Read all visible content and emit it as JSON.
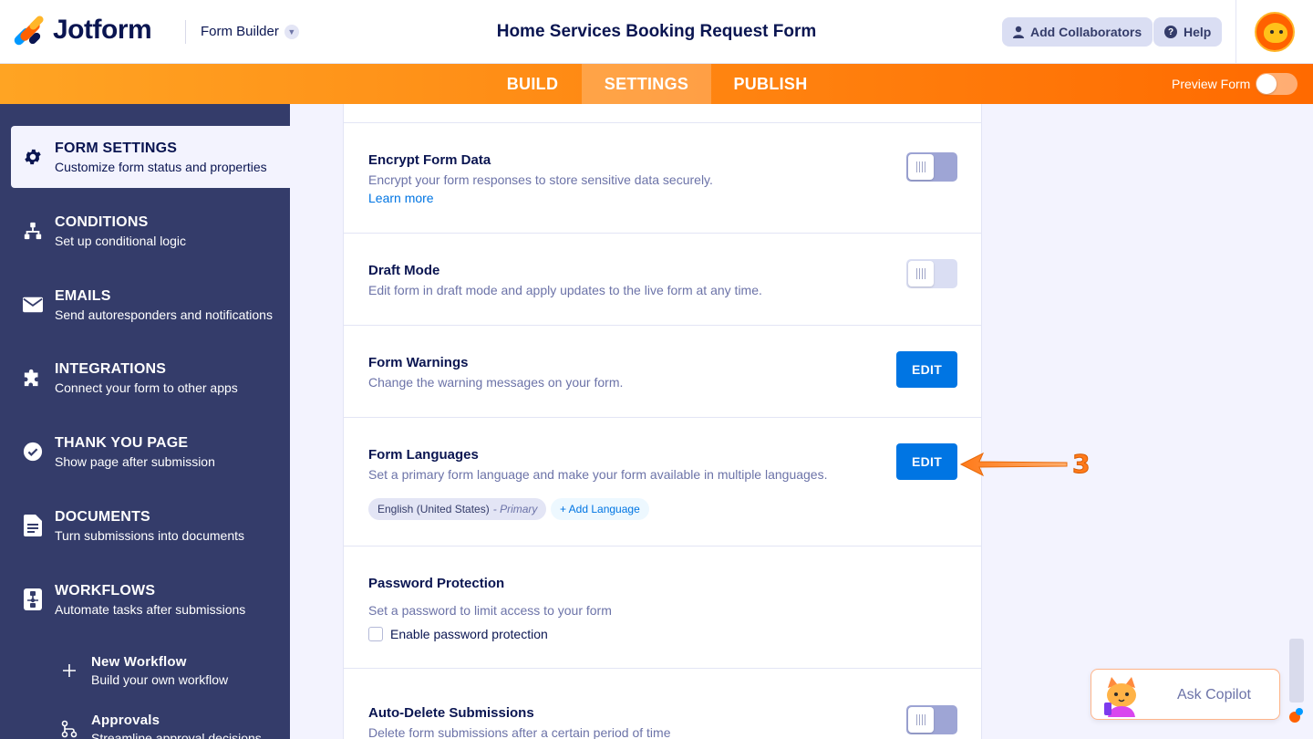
{
  "header": {
    "logo_text": "Jotform",
    "builder_label": "Form Builder",
    "form_title": "Home Services Booking Request Form",
    "add_collaborators": "Add Collaborators",
    "help": "Help"
  },
  "nav": {
    "tabs": [
      {
        "label": "BUILD"
      },
      {
        "label": "SETTINGS"
      },
      {
        "label": "PUBLISH"
      }
    ],
    "active_tab": "SETTINGS",
    "preview_label": "Preview Form"
  },
  "sidebar": {
    "items": [
      {
        "title": "FORM SETTINGS",
        "subtitle": "Customize form status and properties",
        "icon": "gear-icon"
      },
      {
        "title": "CONDITIONS",
        "subtitle": "Set up conditional logic",
        "icon": "hierarchy-icon"
      },
      {
        "title": "EMAILS",
        "subtitle": "Send autoresponders and notifications",
        "icon": "envelope-icon"
      },
      {
        "title": "INTEGRATIONS",
        "subtitle": "Connect your form to other apps",
        "icon": "puzzle-icon"
      },
      {
        "title": "THANK YOU PAGE",
        "subtitle": "Show page after submission",
        "icon": "check-circle-icon"
      },
      {
        "title": "DOCUMENTS",
        "subtitle": "Turn submissions into documents",
        "icon": "document-icon"
      },
      {
        "title": "WORKFLOWS",
        "subtitle": "Automate tasks after submissions",
        "icon": "workflow-icon"
      }
    ],
    "sub_items": [
      {
        "title": "New Workflow",
        "subtitle": "Build your own workflow",
        "icon": "plus-icon"
      },
      {
        "title": "Approvals",
        "subtitle": "Streamline approval decisions",
        "icon": "approval-flow-icon"
      }
    ]
  },
  "settings": {
    "encrypt": {
      "title": "Encrypt Form Data",
      "desc": "Encrypt your form responses to store sensitive data securely.",
      "link": "Learn more",
      "enabled": false
    },
    "draft": {
      "title": "Draft Mode",
      "desc": "Edit form in draft mode and apply updates to the live form at any time.",
      "enabled": false
    },
    "warnings": {
      "title": "Form Warnings",
      "desc": "Change the warning messages on your form.",
      "button": "EDIT"
    },
    "languages": {
      "title": "Form Languages",
      "desc": "Set a primary form language and make your form available in multiple languages.",
      "button": "EDIT",
      "primary_language": "English (United States)",
      "primary_tag": "- Primary",
      "add_language": "+ Add Language"
    },
    "password": {
      "title": "Password Protection",
      "desc": "Set a password to limit access to your form",
      "checkbox_label": "Enable password protection",
      "checked": false
    },
    "auto_delete": {
      "title": "Auto-Delete Submissions",
      "desc": "Delete form submissions after a certain period of time",
      "enabled": false
    }
  },
  "annotation": {
    "step": "3",
    "color": "#ff7a1a"
  },
  "copilot": {
    "label": "Ask Copilot"
  },
  "colors": {
    "orange": "#ff6a00",
    "sidebar": "#343c6a",
    "primary_blue": "#0075e3",
    "text_dark": "#0a1551"
  }
}
